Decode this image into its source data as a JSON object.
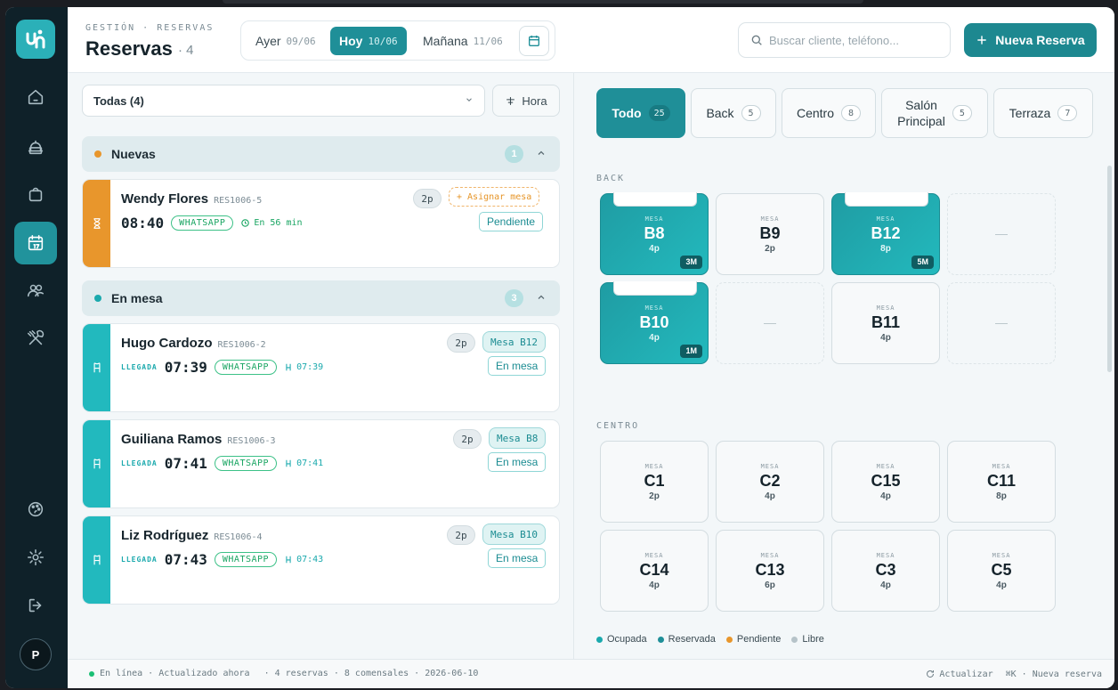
{
  "header": {
    "breadcrumb": "GESTIÓN · RESERVAS",
    "title": "Reservas",
    "count": "· 4",
    "days": [
      {
        "label": "Ayer",
        "date": "09/06"
      },
      {
        "label": "Hoy",
        "date": "10/06"
      },
      {
        "label": "Mañana",
        "date": "11/06"
      }
    ],
    "search_placeholder": "Buscar cliente, teléfono...",
    "new_button": "Nueva Reserva"
  },
  "sidebar": {
    "items": [
      "home-icon",
      "cloche-icon",
      "bag-icon",
      "calendar-icon",
      "users-icon",
      "utensils-icon"
    ],
    "bottom": [
      "palette-icon",
      "gear-icon",
      "logout-icon"
    ],
    "avatar": "P"
  },
  "list": {
    "filter": "Todas (4)",
    "sort": "Hora",
    "groups": [
      {
        "label": "Nuevas",
        "count": "1",
        "color": "#e8962c"
      },
      {
        "label": "En mesa",
        "count": "3",
        "color": "#1aa9ad"
      }
    ],
    "cards": [
      {
        "name": "Wendy Flores",
        "code": "RES1006-5",
        "time": "08:40",
        "channel": "WHATSAPP",
        "info": "En 56 min",
        "people": "2p",
        "mesa": "+ Asignar mesa",
        "status": "Pendiente"
      },
      {
        "name": "Hugo Cardozo",
        "code": "RES1006-2",
        "arrival": "LLEGADA",
        "time": "07:39",
        "channel": "WHATSAPP",
        "info": "07:39",
        "people": "2p",
        "mesa": "Mesa B12",
        "status": "En mesa"
      },
      {
        "name": "Guiliana Ramos",
        "code": "RES1006-3",
        "arrival": "LLEGADA",
        "time": "07:41",
        "channel": "WHATSAPP",
        "info": "07:41",
        "people": "2p",
        "mesa": "Mesa B8",
        "status": "En mesa"
      },
      {
        "name": "Liz Rodríguez",
        "code": "RES1006-4",
        "arrival": "LLEGADA",
        "time": "07:43",
        "channel": "WHATSAPP",
        "info": "07:43",
        "people": "2p",
        "mesa": "Mesa B10",
        "status": "En mesa"
      }
    ]
  },
  "zones": {
    "tabs": [
      {
        "label": "Todo",
        "count": "25"
      },
      {
        "label": "Back",
        "count": "5"
      },
      {
        "label": "Centro",
        "count": "8"
      },
      {
        "label": "Salón",
        "label2": "Principal",
        "count": "5"
      },
      {
        "label": "Terraza",
        "count": "7"
      }
    ],
    "back_label": "BACK",
    "centro_label": "CENTRO",
    "mesa_word": "MESA",
    "empty": "—",
    "back": [
      {
        "name": "B8",
        "cap": "4p",
        "timer": "3M"
      },
      {
        "name": "B9",
        "cap": "2p"
      },
      {
        "name": "B12",
        "cap": "8p",
        "timer": "5M"
      },
      {
        "name": "B10",
        "cap": "4p",
        "timer": "1M"
      },
      {
        "name": "B11",
        "cap": "4p"
      }
    ],
    "centro": [
      {
        "name": "C1",
        "cap": "2p"
      },
      {
        "name": "C2",
        "cap": "4p"
      },
      {
        "name": "C15",
        "cap": "4p"
      },
      {
        "name": "C11",
        "cap": "8p"
      },
      {
        "name": "C14",
        "cap": "4p"
      },
      {
        "name": "C13",
        "cap": "6p"
      },
      {
        "name": "C3",
        "cap": "4p"
      },
      {
        "name": "C5",
        "cap": "4p"
      }
    ],
    "legend": [
      {
        "label": "Ocupada",
        "color": "#1aa9ad"
      },
      {
        "label": "Reservada",
        "color": "#1f8f98"
      },
      {
        "label": "Pendiente",
        "color": "#e8962c"
      },
      {
        "label": "Libre",
        "color": "#b6c3c9"
      }
    ]
  },
  "footer": {
    "status": "En línea · Actualizado ahora",
    "summary": "·  4 reservas · 8 comensales · 2026-06-10",
    "refresh": "Actualizar",
    "shortcut": "⌘K · Nueva reserva"
  }
}
